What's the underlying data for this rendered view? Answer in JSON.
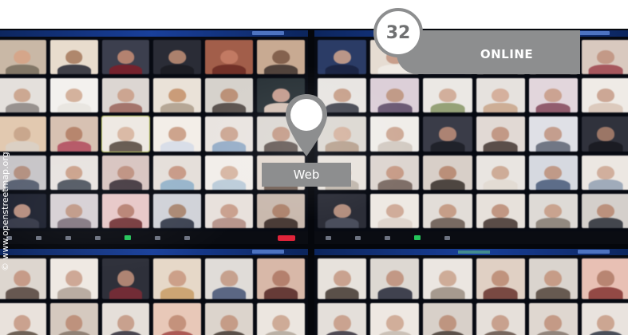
{
  "page": {
    "number": "32",
    "section": "ONLINE"
  },
  "marker": {
    "label": "Web",
    "icon": "location-pin-icon"
  },
  "copyright": "© www.openstreetmap.org",
  "colors": {
    "accent_gray": "#8d8e8f",
    "number_gray": "#6f7071",
    "marker_white": "#ffffff",
    "meeting_bar_blue": "#1c49b3",
    "end_call_red": "#e0243a",
    "active_green": "#24c45a"
  }
}
